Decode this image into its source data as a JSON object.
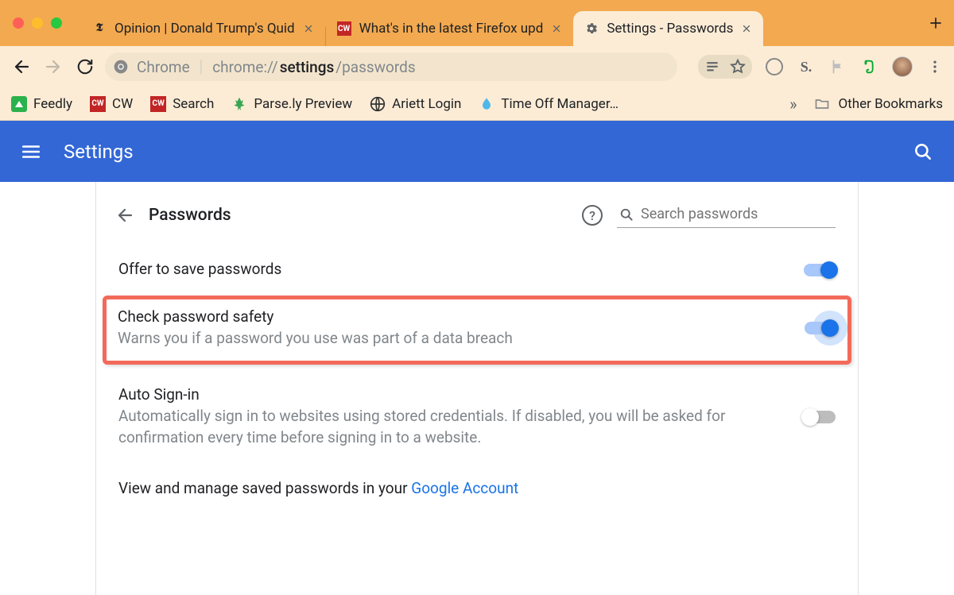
{
  "window": {
    "tabs": [
      {
        "title": "Opinion | Donald Trump's Quid",
        "active": false,
        "favicon": "nyt"
      },
      {
        "title": "What's in the latest Firefox upd",
        "active": false,
        "favicon": "cw"
      },
      {
        "title": "Settings - Passwords",
        "active": true,
        "favicon": "gear"
      }
    ]
  },
  "omnibox": {
    "scheme": "Chrome",
    "url_prefix": "chrome://",
    "url_em": "settings",
    "url_suffix": "/passwords"
  },
  "bookmarks": [
    {
      "label": "Feedly",
      "icon": "feedly"
    },
    {
      "label": "CW",
      "icon": "cw"
    },
    {
      "label": "Search",
      "icon": "cw"
    },
    {
      "label": "Parse.ly Preview",
      "icon": "parsely"
    },
    {
      "label": "Ariett Login",
      "icon": "globe"
    },
    {
      "label": "Time Off Manager…",
      "icon": "drop"
    }
  ],
  "other_bookmarks_label": "Other Bookmarks",
  "appbar": {
    "title": "Settings"
  },
  "page": {
    "title": "Passwords",
    "search_placeholder": "Search passwords",
    "settings": {
      "offer_save": {
        "label": "Offer to save passwords",
        "on": true
      },
      "check_safety": {
        "label": "Check password safety",
        "desc": "Warns you if a password you use was part of a data breach",
        "on": true
      },
      "auto_signin": {
        "label": "Auto Sign-in",
        "desc": "Automatically sign in to websites using stored credentials. If disabled, you will be asked for confirmation every time before signing in to a website.",
        "on": false
      }
    },
    "manage_prefix": "View and manage saved passwords in your ",
    "manage_link": "Google Account"
  }
}
